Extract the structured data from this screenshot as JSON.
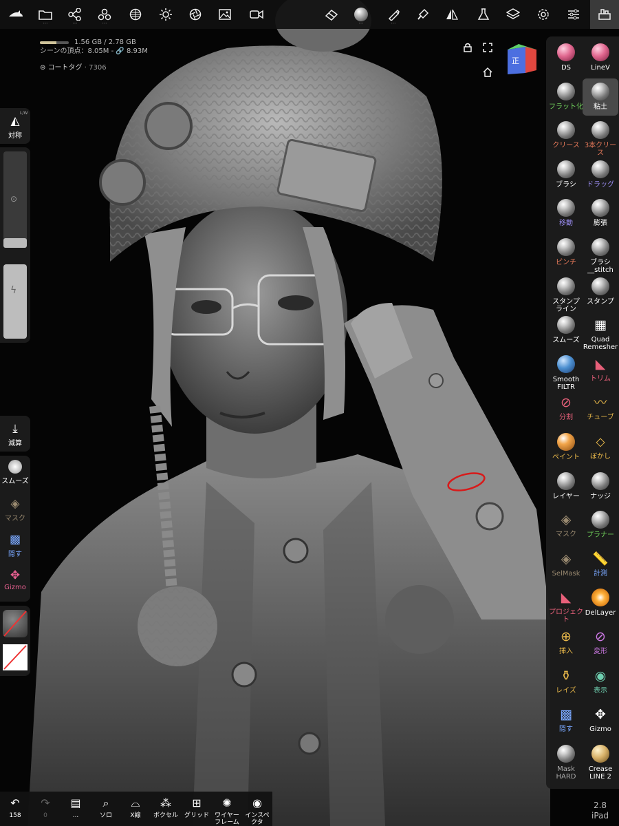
{
  "topbar": {
    "left_icons": [
      "shark-logo-icon",
      "folder-icon",
      "scene-tree-icon",
      "topology-icon",
      "material-sphere-icon",
      "light-icon",
      "camera-aperture-icon",
      "image-icon",
      "video-icon"
    ],
    "right_icons": [
      "eraser-icon",
      "matcap-icon",
      "brush-pen-icon",
      "paint-brush-icon",
      "symmetry-icon",
      "flask-icon",
      "layers-icon",
      "gear-icon",
      "sliders-icon",
      "sculpt-tools-icon"
    ]
  },
  "stats": {
    "memory": "1.56 GB / 2.78 GB",
    "memory_fraction": 0.56,
    "vertices": "シーンの頂点：8.05M - ",
    "vertices_total": "8.93M"
  },
  "tags": {
    "label": "コートタグ",
    "count": "· 7306"
  },
  "view_cube": {
    "front_label": "正"
  },
  "left": {
    "symmetry": "対称",
    "lw_badge": "L/W",
    "decimate": "減算",
    "smooth": "スムーズ",
    "mask": "マスク",
    "hide": "隠す",
    "gizmo": "Gizmo"
  },
  "tools": [
    {
      "label": "DS",
      "icon": "ballpink",
      "color": "#ffffff"
    },
    {
      "label": "LineV",
      "icon": "ballpink",
      "color": "#ffffff"
    },
    {
      "label": "フラット化",
      "icon": "ball",
      "color": "#6fcf5a"
    },
    {
      "label": "粘土",
      "icon": "ball",
      "color": "#ffffff",
      "selected": true
    },
    {
      "label": "クリース",
      "icon": "ball",
      "color": "#e87a5a"
    },
    {
      "label": "3本クリース",
      "icon": "ball",
      "color": "#e87a5a"
    },
    {
      "label": "ブラシ",
      "icon": "ball",
      "color": "#ffffff"
    },
    {
      "label": "ドラッグ",
      "icon": "ball",
      "color": "#9a8cf0"
    },
    {
      "label": "移動",
      "icon": "ball",
      "color": "#9a8cf0"
    },
    {
      "label": "膨張",
      "icon": "ball",
      "color": "#ffffff"
    },
    {
      "label": "ピンチ",
      "icon": "ball",
      "color": "#e87a5a"
    },
    {
      "label": "ブラシ__stitch",
      "icon": "ball",
      "color": "#ffffff"
    },
    {
      "label": "スタンプ ライン",
      "icon": "ball",
      "color": "#ffffff"
    },
    {
      "label": "スタンプ",
      "icon": "ball",
      "color": "#ffffff"
    },
    {
      "label": "スムーズ",
      "icon": "ball",
      "color": "#ffffff"
    },
    {
      "label": "Quad Remesher",
      "glyph": "▦",
      "color": "#ffffff"
    },
    {
      "label": "Smooth FILTR",
      "icon": "ballblue",
      "color": "#ffffff"
    },
    {
      "label": "トリム",
      "glyph": "◣",
      "color": "#e8607a"
    },
    {
      "label": "分割",
      "glyph": "⊘",
      "color": "#e8607a"
    },
    {
      "label": "チューブ",
      "glyph": "〰",
      "color": "#e8b84a"
    },
    {
      "label": "ペイント",
      "icon": "ballorange",
      "color": "#e8b84a"
    },
    {
      "label": "ぼかし",
      "glyph": "⬦",
      "color": "#e8b84a"
    },
    {
      "label": "レイヤー",
      "icon": "ball",
      "color": "#ffffff"
    },
    {
      "label": "ナッジ",
      "icon": "ball",
      "color": "#ffffff"
    },
    {
      "label": "マスク",
      "glyph": "◈",
      "color": "#9a8a70"
    },
    {
      "label": "プラナー",
      "icon": "ball",
      "color": "#6fcf5a"
    },
    {
      "label": "SelMask",
      "glyph": "◈",
      "color": "#9a8a70"
    },
    {
      "label": "計測",
      "glyph": "📏",
      "color": "#7aa8ff"
    },
    {
      "label": "プロジェクト",
      "glyph": "◣",
      "color": "#e8607a"
    },
    {
      "label": "DelLayer",
      "icon": "ballfire",
      "color": "#ffffff"
    },
    {
      "label": "挿入",
      "glyph": "⊕",
      "color": "#e8b84a"
    },
    {
      "label": "変形",
      "glyph": "⊘",
      "color": "#d07ae8"
    },
    {
      "label": "レイズ",
      "glyph": "⚱",
      "color": "#e8b84a"
    },
    {
      "label": "表示",
      "glyph": "◉",
      "color": "#6fcfb0"
    },
    {
      "label": "隠す",
      "glyph": "▩",
      "color": "#7aa8ff"
    },
    {
      "label": "Gizmo",
      "glyph": "✥",
      "color": "#ffffff"
    },
    {
      "label": "Mask HARD",
      "icon": "ball",
      "color": "#aaaaaa"
    },
    {
      "label": "Crease LINE 2",
      "icon": "ballgold",
      "color": "#ffffff"
    }
  ],
  "bottombar": [
    {
      "label": "158",
      "icon": "undo-icon",
      "glyph": "↶"
    },
    {
      "label": "0",
      "icon": "redo-icon",
      "glyph": "↷"
    },
    {
      "label": "...",
      "icon": "history-icon",
      "glyph": "▤"
    },
    {
      "label": "ソロ",
      "icon": "search-icon",
      "glyph": "⌕"
    },
    {
      "label": "X線",
      "icon": "glasses-icon",
      "glyph": "⌓"
    },
    {
      "label": "ボクセル",
      "icon": "voxel-icon",
      "glyph": "⁂"
    },
    {
      "label": "グリッド",
      "icon": "grid-icon",
      "glyph": "⊞"
    },
    {
      "label": "ワイヤーフレーム",
      "icon": "wireframe-icon",
      "glyph": "✺"
    },
    {
      "label": "インスペクタ",
      "icon": "inspector-icon",
      "glyph": "◉"
    }
  ],
  "device": {
    "version": "2.8",
    "name": "iPad"
  }
}
